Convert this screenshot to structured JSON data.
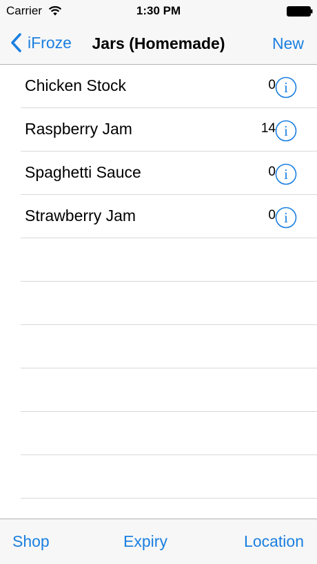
{
  "status_bar": {
    "carrier": "Carrier",
    "time": "1:30 PM",
    "icons": [
      "wifi-icon",
      "battery-icon"
    ]
  },
  "nav": {
    "back_label": "iFroze",
    "title": "Jars (Homemade)",
    "new_label": "New"
  },
  "items": [
    {
      "title": "Chicken Stock",
      "count": "0"
    },
    {
      "title": "Raspberry Jam",
      "count": "14"
    },
    {
      "title": "Spaghetti Sauce",
      "count": "0"
    },
    {
      "title": "Strawberry Jam",
      "count": "0"
    }
  ],
  "tabs": {
    "shop": "Shop",
    "expiry": "Expiry",
    "location": "Location"
  },
  "colors": {
    "accent": "#1a7fe0",
    "bar_background": "#f7f7f7",
    "separator": "#d8d8d8"
  }
}
